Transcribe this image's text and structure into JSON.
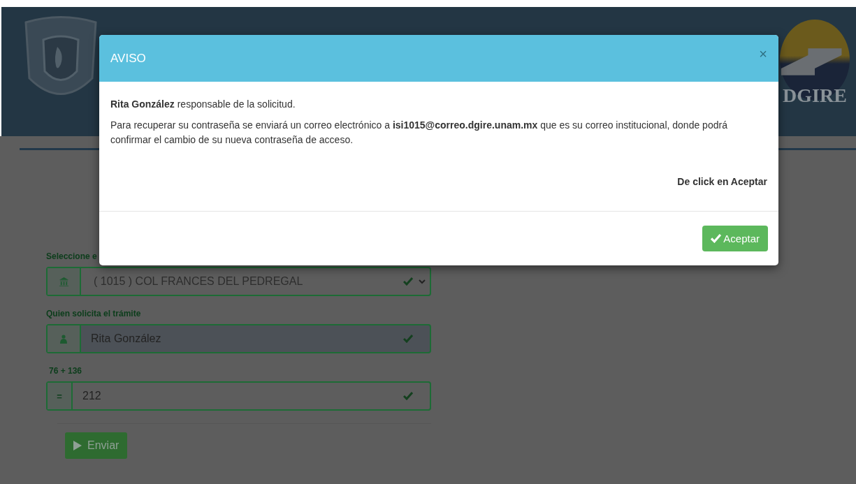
{
  "header": {
    "logo_text": "DGIRE"
  },
  "form": {
    "fields": [
      {
        "label": "Seleccione e",
        "kind": "select",
        "value": "( 1015 ) COL FRANCES DEL PEDREGAL"
      },
      {
        "label": "Quien solicita el trámite",
        "kind": "person",
        "value": "Rita González"
      },
      {
        "label": "76 + 136",
        "kind": "sum",
        "addon": "=",
        "value": "212"
      }
    ],
    "submit": "Enviar"
  },
  "modal": {
    "title": "AVISO",
    "close": "×",
    "paragraphs": [
      "**Rita González** responsable de la solicitud.",
      "Para recuperar su contraseña se enviará un correo electrónico a **isi1015@correo.dgire.unam.mx** que es su correo institucional, donde podrá confirmar el cambio de su nueva contraseña de acceso."
    ],
    "instruction": "De click en Aceptar",
    "button": "Aceptar"
  }
}
